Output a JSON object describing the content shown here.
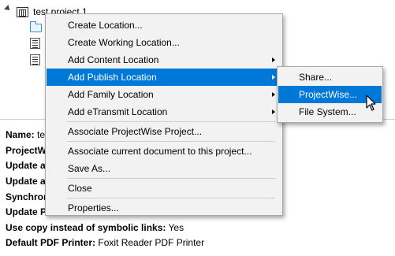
{
  "tree": {
    "project_label": "test project 1"
  },
  "properties": [
    {
      "key": "Name:",
      "value": "te"
    },
    {
      "key": "ProjectW",
      "value": ""
    },
    {
      "key": "Update a",
      "value": ""
    },
    {
      "key": "Update a",
      "value": ""
    },
    {
      "key": "Synchron",
      "value": ""
    },
    {
      "key": "Update P",
      "value": ""
    },
    {
      "key": "Use copy instead of symbolic links:",
      "value": "Yes"
    },
    {
      "key": "Default PDF Printer:",
      "value": "Foxit Reader PDF Printer"
    }
  ],
  "context_menu": {
    "items": [
      {
        "label": "Create Location..."
      },
      {
        "label": "Create Working Location..."
      },
      {
        "label": "Add Content Location"
      },
      {
        "label": "Add Publish Location"
      },
      {
        "label": "Add Family Location"
      },
      {
        "label": "Add eTransmit Location"
      },
      {
        "label": "Associate ProjectWise Project..."
      },
      {
        "label": "Associate current document to this project..."
      },
      {
        "label": "Save As..."
      },
      {
        "label": "Close"
      },
      {
        "label": "Properties..."
      }
    ],
    "highlighted": "Add Publish Location"
  },
  "submenu": {
    "items": [
      {
        "label": "Share..."
      },
      {
        "label": "ProjectWise..."
      },
      {
        "label": "File System..."
      }
    ],
    "highlighted": "ProjectWise..."
  },
  "colors": {
    "highlight": "#0078d7",
    "menu_bg": "#f2f2f2"
  }
}
